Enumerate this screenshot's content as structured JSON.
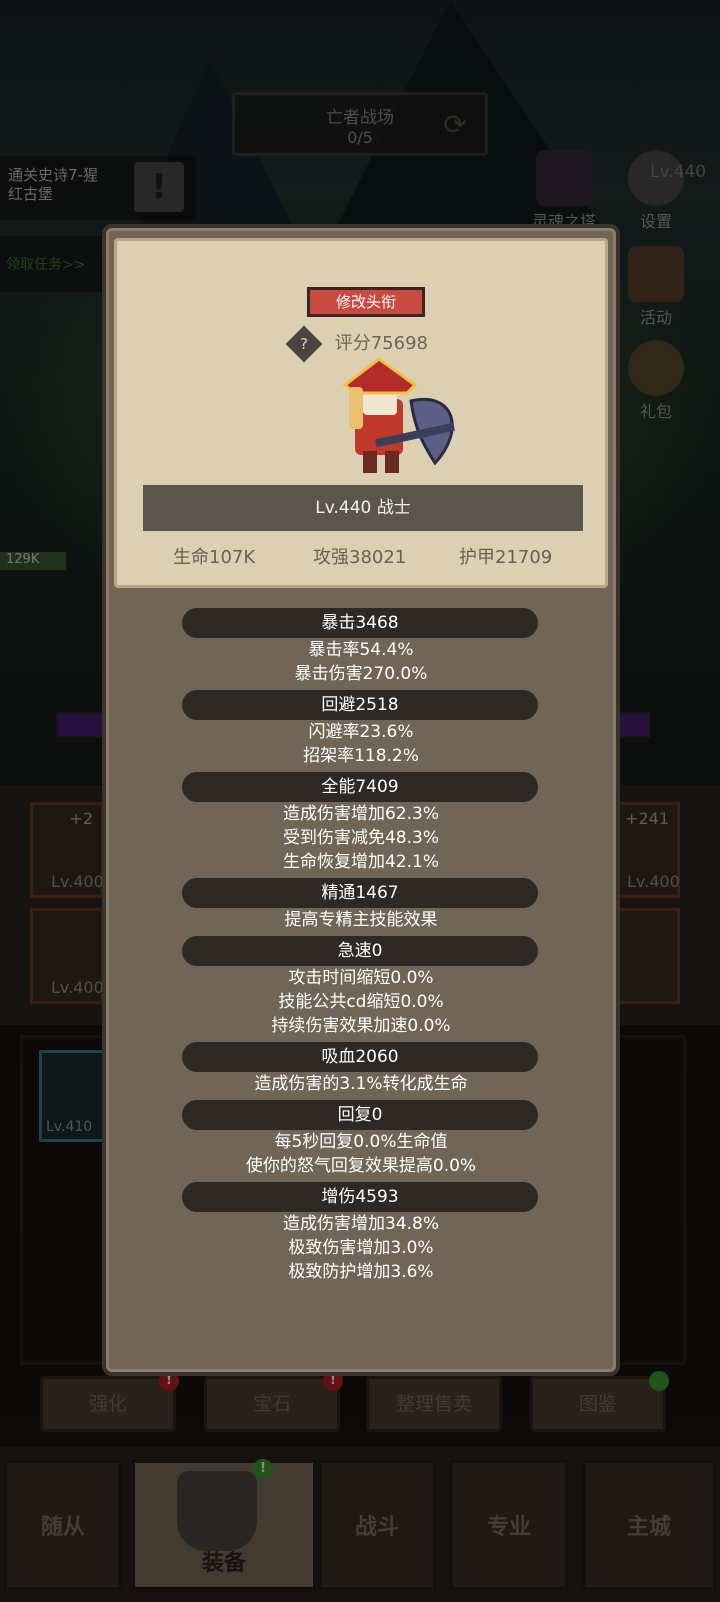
{
  "background": {
    "map_title": "亡者战场",
    "map_progress": "0/5",
    "quest_text_line1": "通关史诗7-猩",
    "quest_text_line2": "红古堡",
    "claim_task": "领取任务>>",
    "right_icons": [
      {
        "label": "灵魂之塔",
        "icon": "tower-icon"
      },
      {
        "label": "设置",
        "icon": "gear-icon"
      },
      {
        "label": "活动",
        "icon": "calendar-icon"
      },
      {
        "label": "礼包",
        "icon": "gift-icon"
      }
    ],
    "level_corner": "Lv.440",
    "hp_tag": "129K",
    "equip_left_plus": "+2",
    "equip_left_lv1": "Lv.400",
    "equip_left_lv2": "Lv.400",
    "equip_right_plus": "+241",
    "equip_right_lv": "Lv.400",
    "bag_item_lv": "Lv.410",
    "function_buttons": [
      "强化",
      "宝石",
      "整理售卖",
      "图鉴"
    ],
    "nav": [
      "随从",
      "装备",
      "战斗",
      "专业",
      "主城"
    ],
    "badge_mark": "!"
  },
  "modal": {
    "edit_title_button": "修改头衔",
    "score": "评分75698",
    "level_class": "Lv.440 战士",
    "hp": "生命107K",
    "attack": "攻强38021",
    "armor": "护甲21709",
    "stats": [
      {
        "name": "暴击3468",
        "details": [
          "暴击率54.4%",
          "暴击伤害270.0%"
        ]
      },
      {
        "name": "回避2518",
        "details": [
          "闪避率23.6%",
          "招架率118.2%"
        ]
      },
      {
        "name": "全能7409",
        "details": [
          "造成伤害增加62.3%",
          "受到伤害减免48.3%",
          "生命恢复增加42.1%"
        ]
      },
      {
        "name": "精通1467",
        "details": [
          "提高专精主技能效果"
        ]
      },
      {
        "name": "急速0",
        "details": [
          "攻击时间缩短0.0%",
          "技能公共cd缩短0.0%",
          "持续伤害效果加速0.0%"
        ]
      },
      {
        "name": "吸血2060",
        "details": [
          "造成伤害的3.1%转化成生命"
        ]
      },
      {
        "name": "回复0",
        "details": [
          "每5秒回复0.0%生命值",
          "使你的怒气回复效果提高0.0%"
        ]
      },
      {
        "name": "增伤4593",
        "details": [
          "造成伤害增加34.8%",
          "极致伤害增加3.0%",
          "极致防护增加3.6%"
        ]
      }
    ]
  },
  "colors": {
    "card_bg": "#ddd0b2",
    "panel_bg": "#706556",
    "title_button": "#c84a43",
    "category_pill": "#2e2925"
  }
}
